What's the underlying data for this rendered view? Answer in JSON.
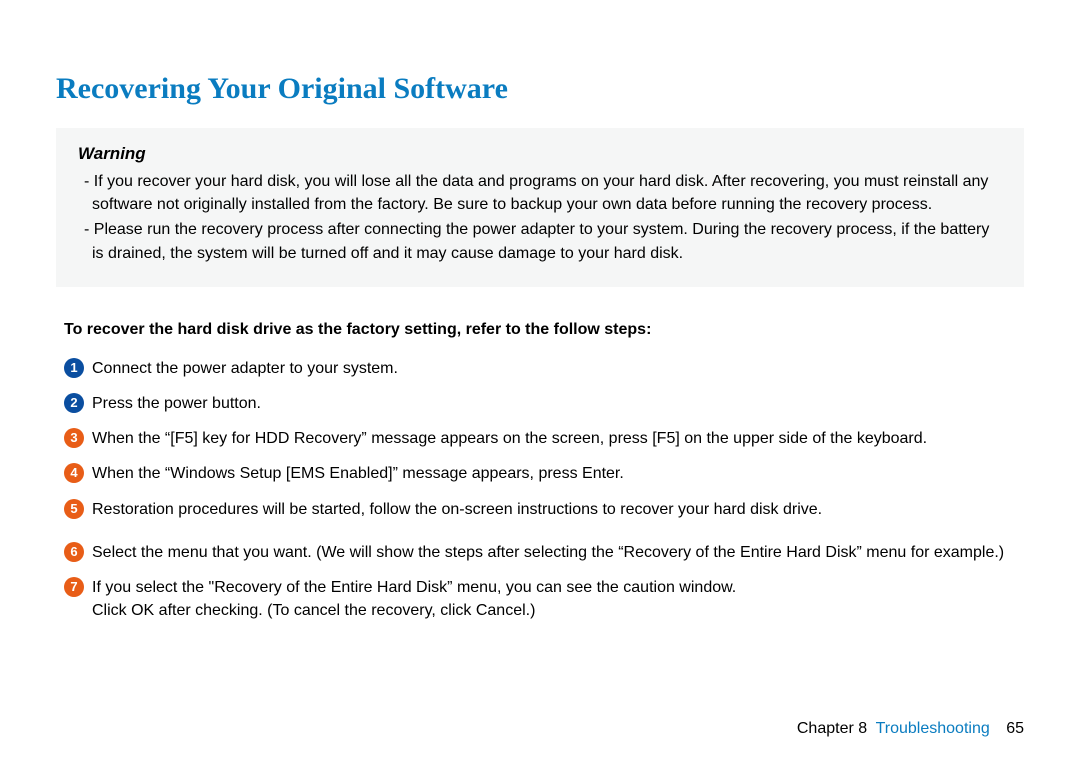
{
  "title": "Recovering Your Original Software",
  "warning": {
    "heading": "Warning",
    "items": [
      "- If you recover your hard disk, you will lose all the data and programs on your hard disk. After recovering, you must reinstall any software not originally installed from the factory. Be sure to backup your own data before running the recovery process.",
      "- Please run the recovery process after connecting the power adapter to your system. During the recovery process, if the battery is drained, the system will be turned off and it may cause damage to your hard disk."
    ]
  },
  "instructions_heading": "To recover the hard disk drive as the factory setting, refer to the follow steps:",
  "steps": [
    {
      "n": "1",
      "color": "blue",
      "text": "Connect the power adapter to your system."
    },
    {
      "n": "2",
      "color": "blue",
      "text": "Press the power button."
    },
    {
      "n": "3",
      "color": "red",
      "text": "When the “[F5] key for HDD Recovery” message appears on the screen, press [F5] on the upper side of the keyboard."
    },
    {
      "n": "4",
      "color": "red",
      "text": "When the “Windows Setup [EMS Enabled]” message appears, press Enter."
    },
    {
      "n": "5",
      "color": "red",
      "text": "Restoration procedures will be started, follow the on-screen instructions to recover your hard disk drive."
    },
    {
      "n": "6",
      "color": "red",
      "text": "Select the menu that you want. (We will show the steps after selecting the “Recovery of the Entire Hard Disk” menu for example.)"
    },
    {
      "n": "7",
      "color": "red",
      "text": "If you select the \"Recovery of the Entire Hard Disk” menu, you can see the caution window.\nClick OK after checking. (To cancel the recovery, click Cancel.)"
    }
  ],
  "footer": {
    "chapter_label": "Chapter 8",
    "section_label": "Troubleshooting",
    "page_number": "65"
  }
}
